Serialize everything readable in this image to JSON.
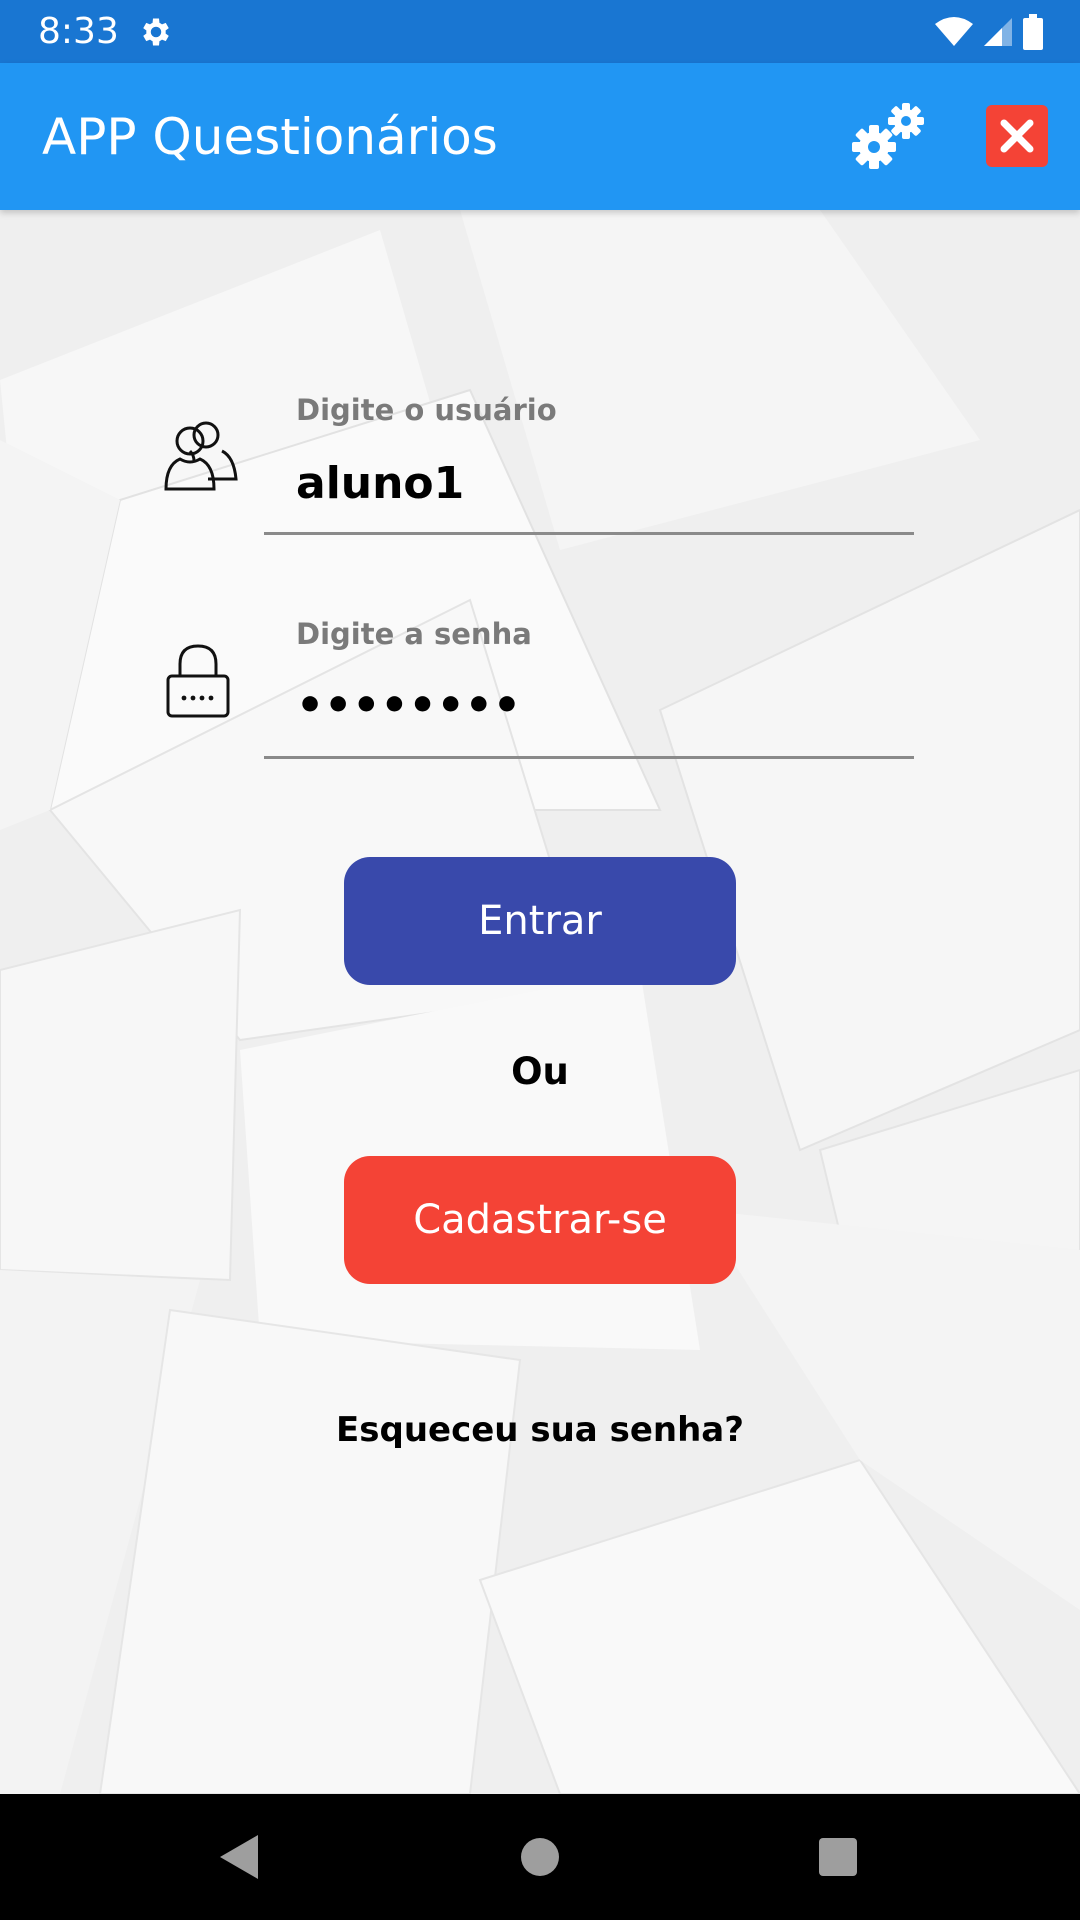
{
  "status_bar": {
    "time": "8:33",
    "icons": [
      "settings-icon",
      "wifi-icon",
      "signal-icon",
      "battery-icon"
    ]
  },
  "app_bar": {
    "title": "APP Questionários",
    "settings_icon": "gears-icon",
    "close_icon": "close-icon"
  },
  "login_form": {
    "username": {
      "label": "Digite o usuário",
      "value": "aluno1",
      "icon": "users-icon"
    },
    "password": {
      "label": "Digite a senha",
      "value": "••••••••",
      "icon": "lock-icon"
    },
    "login_button": "Entrar",
    "or_text": "Ou",
    "signup_button": "Cadastrar-se",
    "forgot_password": "Esqueceu sua senha?"
  },
  "nav_bar": {
    "icons": [
      "back-icon",
      "home-icon",
      "recents-icon"
    ]
  },
  "colors": {
    "status_bar": "#1976d2",
    "app_bar": "#2196f3",
    "login_button": "#3949ab",
    "signup_button": "#f44336",
    "close_button": "#f44336"
  }
}
